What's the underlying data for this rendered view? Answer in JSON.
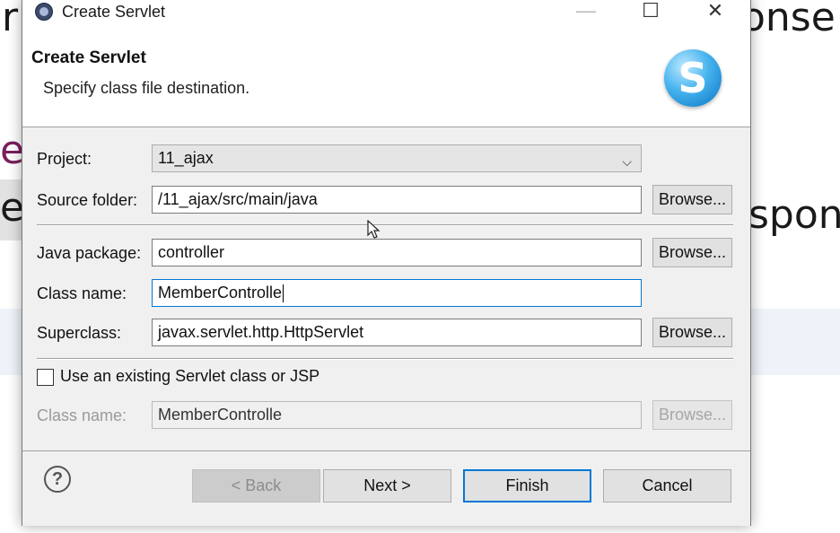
{
  "background": {
    "top_left_fragment": "r",
    "top_right_fragment": "onse",
    "mid_left_fragment_1": "e",
    "mid_left_fragment_2": "e",
    "mid_right_fragment": "spon",
    "accent_color": "#7a1f5c"
  },
  "window": {
    "title": "Create Servlet",
    "icon": "eclipse-icon",
    "minimize_icon": "minimize-icon",
    "maximize_icon": "maximize-icon",
    "close_icon": "close-icon",
    "minimize_glyph": "—",
    "maximize_glyph": "☐",
    "close_glyph": "✕"
  },
  "header": {
    "title": "Create Servlet",
    "subtitle": "Specify class file destination.",
    "logo_icon": "servlet-logo-icon",
    "logo_letter": "S"
  },
  "form": {
    "project": {
      "label": "Project:",
      "value": "11_ajax",
      "dropdown_arrow": "⌵"
    },
    "source_folder": {
      "label": "Source folder:",
      "value": "/11_ajax/src/main/java",
      "browse_label": "Browse..."
    },
    "java_package": {
      "label": "Java package:",
      "value": "controller",
      "browse_label": "Browse..."
    },
    "class_name": {
      "label": "Class name:",
      "value": "MemberControlle"
    },
    "superclass": {
      "label": "Superclass:",
      "value": "javax.servlet.http.HttpServlet",
      "browse_label": "Browse..."
    },
    "use_existing": {
      "label": "Use an existing Servlet class or JSP",
      "checked": false
    },
    "existing_class_name": {
      "label": "Class name:",
      "value": "MemberControlle",
      "browse_label": "Browse..."
    }
  },
  "buttons": {
    "help_glyph": "?",
    "back": "< Back",
    "next": "Next >",
    "finish": "Finish",
    "cancel": "Cancel"
  },
  "colors": {
    "focus_blue": "#0078d7",
    "dialog_bg": "#f0f0f0"
  }
}
